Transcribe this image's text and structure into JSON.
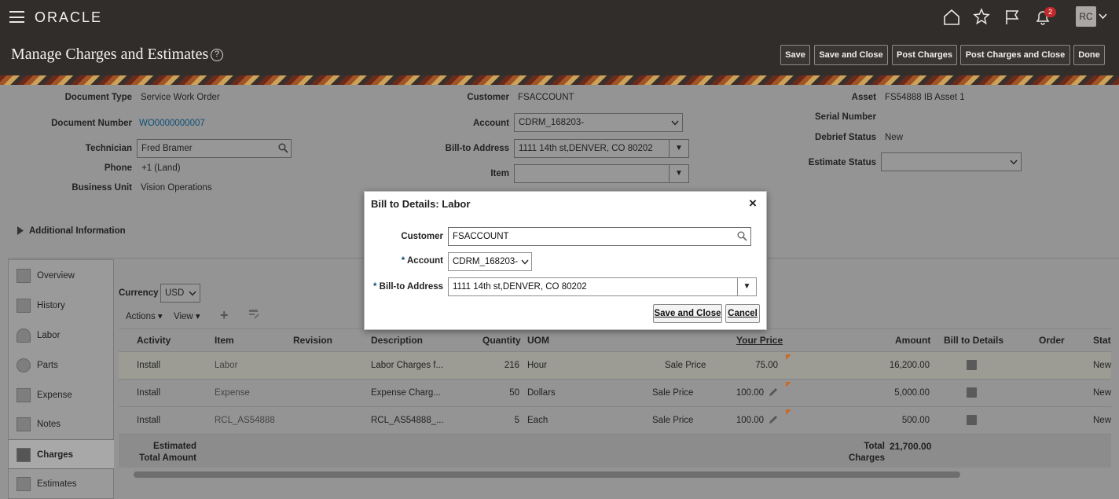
{
  "header": {
    "brand": "ORACLE",
    "notification_count": "2",
    "user_initials": "RC"
  },
  "page": {
    "title": "Manage Charges and Estimates",
    "buttons": [
      "Save",
      "Save and Close",
      "Post Charges",
      "Post Charges and Close",
      "Done"
    ]
  },
  "form": {
    "document_type_label": "Document Type",
    "document_type": "Service Work Order",
    "document_number_label": "Document Number",
    "document_number": "WO0000000007",
    "technician_label": "Technician",
    "technician": "Fred Bramer",
    "phone_label": "Phone",
    "phone": "+1 (Land)",
    "business_unit_label": "Business Unit",
    "business_unit": "Vision Operations",
    "customer_label": "Customer",
    "customer": "FSACCOUNT",
    "account_label": "Account",
    "account": "CDRM_168203-",
    "bill_to_label": "Bill-to Address",
    "bill_to": "1111 14th st,DENVER, CO 80202",
    "item_label": "Item",
    "item": "",
    "asset_label": "Asset",
    "asset": "FS54888 IB Asset 1",
    "serial_label": "Serial Number",
    "serial": "",
    "debrief_label": "Debrief Status",
    "debrief": "New",
    "estimate_status_label": "Estimate Status",
    "estimate_status": "",
    "additional_info": "Additional Information"
  },
  "nav": {
    "items": [
      "Overview",
      "History",
      "Labor",
      "Parts",
      "Expense",
      "Notes",
      "Charges",
      "Estimates"
    ],
    "selected": "Charges"
  },
  "toolbar": {
    "currency_label": "Currency",
    "currency": "USD",
    "actions": "Actions",
    "view": "View"
  },
  "table": {
    "headers": [
      "Activity",
      "Item",
      "Revision",
      "Description",
      "Quantity",
      "UOM",
      "Your Price",
      "Amount",
      "Bill to Details",
      "Order",
      "Status"
    ],
    "rows": [
      {
        "activity": "Install",
        "item": "Labor",
        "description": "Labor Charges f...",
        "quantity": "216",
        "uom": "Hour",
        "price_type": "Sale Price",
        "price": "75.00",
        "amount": "16,200.00",
        "status": "New"
      },
      {
        "activity": "Install",
        "item": "Expense",
        "description": "Expense Charg...",
        "quantity": "50",
        "uom": "Dollars",
        "price_type": "Sale Price",
        "price": "100.00",
        "amount": "5,000.00",
        "status": "New"
      },
      {
        "activity": "Install",
        "item": "RCL_AS54888",
        "description": "RCL_AS54888_...",
        "quantity": "5",
        "uom": "Each",
        "price_type": "Sale Price",
        "price": "100.00",
        "amount": "500.00",
        "status": "New"
      }
    ],
    "footer_left_1": "Estimated",
    "footer_left_2": "Total Amount",
    "footer_right_1": "Total",
    "footer_right_2": "Charges",
    "total": "21,700.00"
  },
  "dialog": {
    "title": "Bill to Details: Labor",
    "customer_label": "Customer",
    "customer": "FSACCOUNT",
    "account_label": "Account",
    "account": "CDRM_168203-",
    "bill_to_label": "Bill-to Address",
    "bill_to": "1111 14th st,DENVER, CO 80202",
    "save_close": "Save and Close",
    "cancel": "Cancel"
  }
}
